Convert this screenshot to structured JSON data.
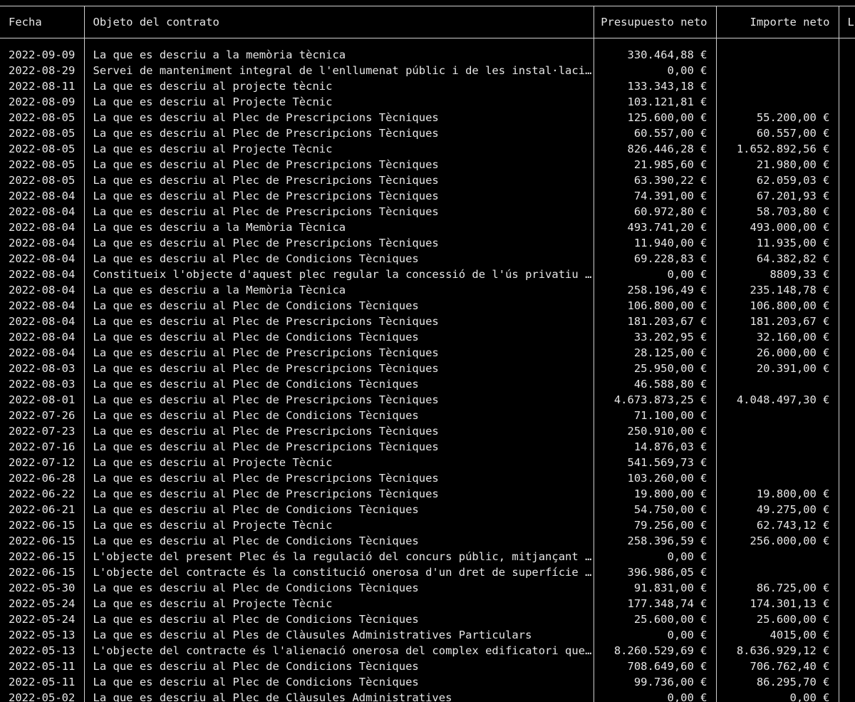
{
  "table": {
    "columns": [
      "Fecha",
      "Objeto del contrato",
      "Presupuesto neto",
      "Importe neto",
      "Lo"
    ],
    "rows": [
      [
        "2022-09-09",
        "La que es descriu a la memòria tècnica",
        "330.464,88 €",
        ""
      ],
      [
        "2022-08-29",
        "Servei de manteniment integral de l'enllumenat públic i de les instal·lacio…",
        "0,00 €",
        ""
      ],
      [
        "2022-08-11",
        "La que es descriu al projecte tècnic",
        "133.343,18 €",
        ""
      ],
      [
        "2022-08-09",
        "La que es descriu al Projecte Tècnic",
        "103.121,81 €",
        ""
      ],
      [
        "2022-08-05",
        "La que es descriu al Plec de Prescripcions Tècniques",
        "125.600,00 €",
        "55.200,00 €"
      ],
      [
        "2022-08-05",
        "La que es descriu al Plec de Prescripcions Tècniques",
        "60.557,00 €",
        "60.557,00 €"
      ],
      [
        "2022-08-05",
        "La que es descriu al Projecte Tècnic",
        "826.446,28 €",
        "1.652.892,56 €"
      ],
      [
        "2022-08-05",
        "La que es descriu al Plec de Prescripcions Tècniques",
        "21.985,60 €",
        "21.980,00 €"
      ],
      [
        "2022-08-05",
        "La que es descriu al Plec de Prescripcions Tècniques",
        "63.390,22 €",
        "62.059,03 €"
      ],
      [
        "2022-08-04",
        "La que es descriu al Plec de Prescripcions Tècniques",
        "74.391,00 €",
        "67.201,93 €"
      ],
      [
        "2022-08-04",
        "La que es descriu al Plec de Prescripcions Tècniques",
        "60.972,80 €",
        "58.703,80 €"
      ],
      [
        "2022-08-04",
        "La que es descriu a la Memòria Tècnica",
        "493.741,20 €",
        "493.000,00 €"
      ],
      [
        "2022-08-04",
        "La que es descriu al Plec de Prescripcions Tècniques",
        "11.940,00 €",
        "11.935,00 €"
      ],
      [
        "2022-08-04",
        "La que es descriu al Plec de Condicions Tècniques",
        "69.228,83 €",
        "64.382,82 €"
      ],
      [
        "2022-08-04",
        "Constitueix l'objecte d'aquest plec regular la concessió de l'ús privatiu d…",
        "0,00 €",
        "8809,33 €"
      ],
      [
        "2022-08-04",
        "La que es descriu a la Memòria Tècnica",
        "258.196,49 €",
        "235.148,78 €"
      ],
      [
        "2022-08-04",
        "La que es descriu al Plec de Condicions Tècniques",
        "106.800,00 €",
        "106.800,00 €"
      ],
      [
        "2022-08-04",
        "La que es descriu al Plec de Prescripcions Tècniques",
        "181.203,67 €",
        "181.203,67 €"
      ],
      [
        "2022-08-04",
        "La que es descriu al Plec de Condicions Tècniques",
        "33.202,95 €",
        "32.160,00 €"
      ],
      [
        "2022-08-04",
        "La que es descriu al Plec de Prescripcions Tècniques",
        "28.125,00 €",
        "26.000,00 €"
      ],
      [
        "2022-08-03",
        "La que es descriu al Plec de Prescripcions Tècniques",
        "25.950,00 €",
        "20.391,00 €"
      ],
      [
        "2022-08-03",
        "La que es descriu al Plec de Condicions Tècniques",
        "46.588,80 €",
        ""
      ],
      [
        "2022-08-01",
        "La que es descriu al Plec de Prescripcions Tècniques",
        "4.673.873,25 €",
        "4.048.497,30 €"
      ],
      [
        "2022-07-26",
        "La que es descriu al Plec de Condicions Tècniques",
        "71.100,00 €",
        ""
      ],
      [
        "2022-07-23",
        "La que es descriu al Plec de Prescripcions Tècniques",
        "250.910,00 €",
        ""
      ],
      [
        "2022-07-16",
        "La que es descriu al Plec de Prescripcions Tècniques",
        "14.876,03 €",
        ""
      ],
      [
        "2022-07-12",
        "La que es descriu al Projecte Tècnic",
        "541.569,73 €",
        ""
      ],
      [
        "2022-06-28",
        "La que es descriu al Plec de Prescripcions Tècniques",
        "103.260,00 €",
        ""
      ],
      [
        "2022-06-22",
        "La que es descriu al Plec de Prescripcions Tècniques",
        "19.800,00 €",
        "19.800,00 €"
      ],
      [
        "2022-06-21",
        "La que es descriu al Plec de Condicions Tècniques",
        "54.750,00 €",
        "49.275,00 €"
      ],
      [
        "2022-06-15",
        "La que es descriu al Projecte Tècnic",
        "79.256,00 €",
        "62.743,12 €"
      ],
      [
        "2022-06-15",
        "La que es descriu al Plec de Condicions Tècniques",
        "258.396,59 €",
        "256.000,00 €"
      ],
      [
        "2022-06-15",
        "L'objecte del present Plec és la regulació del concurs públic, mitjançant p…",
        "0,00 €",
        ""
      ],
      [
        "2022-06-15",
        "L'objecte del contracte és la constitució onerosa d'un dret de superfície s…",
        "396.986,05 €",
        ""
      ],
      [
        "2022-05-30",
        "La que es descriu al Plec de Condicions Tècniques",
        "91.831,00 €",
        "86.725,00 €"
      ],
      [
        "2022-05-24",
        "La que es descriu al Projecte Tècnic",
        "177.348,74 €",
        "174.301,13 €"
      ],
      [
        "2022-05-24",
        "La que es descriu al Plec de Condicions Tècniques",
        "25.600,00 €",
        "25.600,00 €"
      ],
      [
        "2022-05-13",
        "La que es descriu al Ples de Clàusules Administratives Particulars",
        "0,00 €",
        "4015,00 €"
      ],
      [
        "2022-05-13",
        "L'objecte del contracte és l'alienació onerosa del complex edificatori que …",
        "8.260.529,69 €",
        "8.636.929,12 €"
      ],
      [
        "2022-05-11",
        "La que es descriu al Plec de Condicions Tècniques",
        "708.649,60 €",
        "706.762,40 €"
      ],
      [
        "2022-05-11",
        "La que es descriu al Plec de Condicions Tècniques",
        "99.736,00 €",
        "86.295,70 €"
      ],
      [
        "2022-05-02",
        "La que es descriu al Plec de Clàusules Administratives",
        "0,00 €",
        "0,00 €"
      ]
    ]
  }
}
